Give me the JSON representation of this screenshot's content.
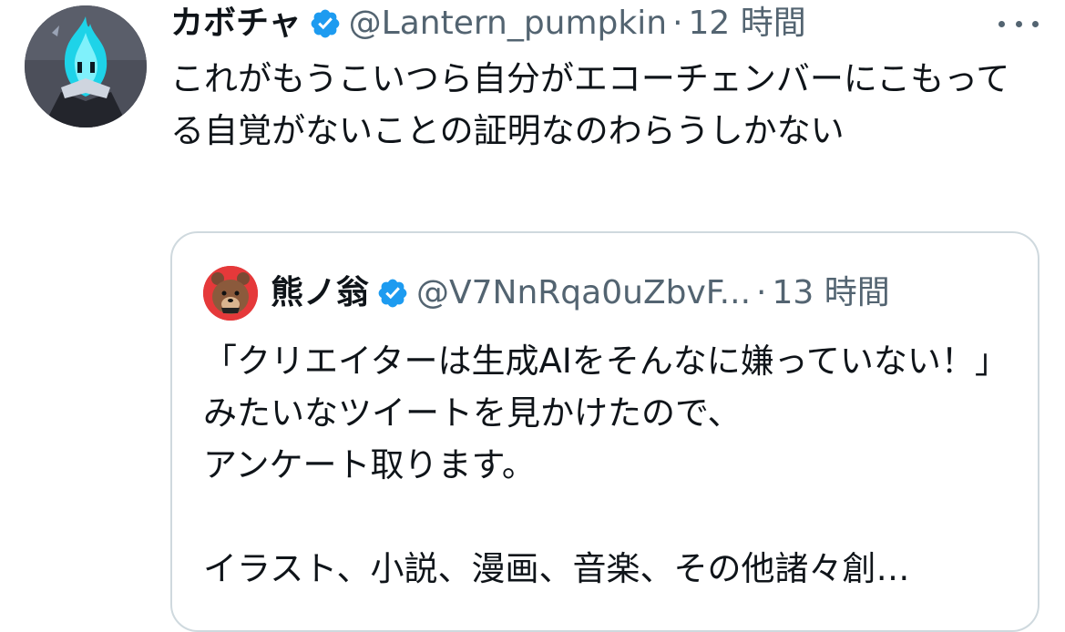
{
  "tweet": {
    "display_name": "カボチャ",
    "handle": "@Lantern_pumpkin",
    "separator": "·",
    "time": "12 時間",
    "text": "これがもうこいつら自分がエコーチェンバーにこもってる自覚がないことの証明なのわらうしかない",
    "avatar_icon": "blue-flame-character-avatar",
    "verified_icon": "verified-badge-icon",
    "more_icon": "more-options-icon"
  },
  "quoted": {
    "display_name": "熊ノ翁",
    "handle": "@V7NnRqa0uZbvF...",
    "separator": "·",
    "time": "13 時間",
    "text": "「クリエイターは生成AIをそんなに嫌っていない！」みたいなツイートを見かけたので、\nアンケート取ります。\n\nイラスト、小説、漫画、音楽、その他諸々創…",
    "avatar_icon": "bear-avatar",
    "verified_icon": "verified-badge-icon"
  },
  "colors": {
    "text": "#0f1419",
    "muted": "#536471",
    "verified": "#1d9bf0",
    "border": "#cfd9de"
  }
}
